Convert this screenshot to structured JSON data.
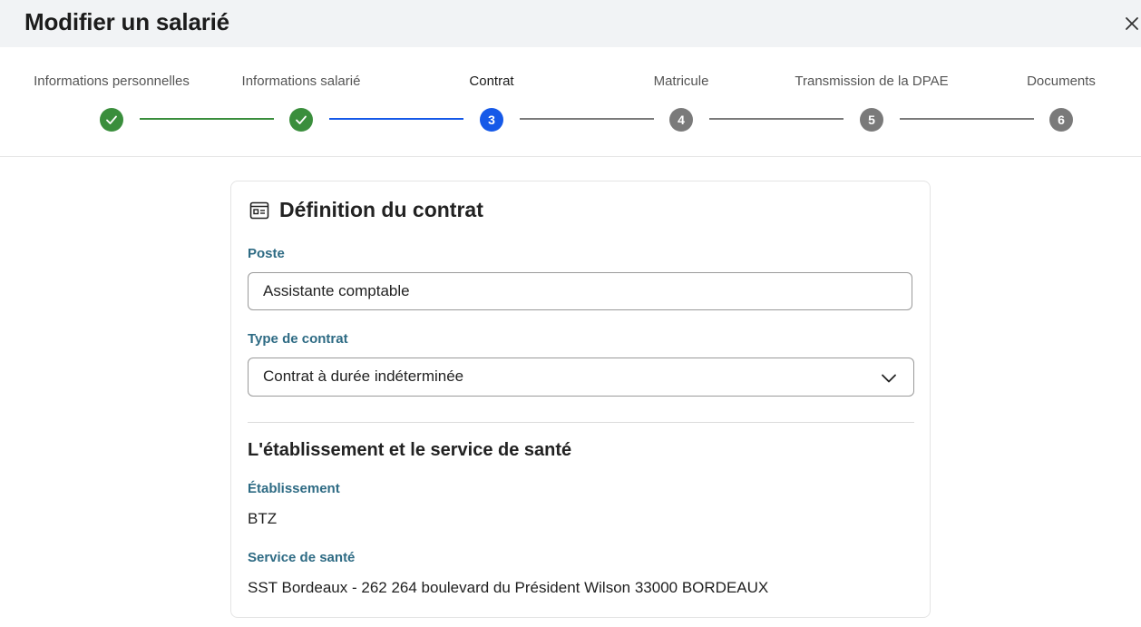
{
  "header": {
    "title": "Modifier un salarié"
  },
  "steps": [
    {
      "label": "Informations personnelles",
      "number": "1",
      "status": "done"
    },
    {
      "label": "Informations salarié",
      "number": "2",
      "status": "done"
    },
    {
      "label": "Contrat",
      "number": "3",
      "status": "active"
    },
    {
      "label": "Matricule",
      "number": "4",
      "status": "todo"
    },
    {
      "label": "Transmission de la DPAE",
      "number": "5",
      "status": "todo"
    },
    {
      "label": "Documents",
      "number": "6",
      "status": "todo"
    }
  ],
  "card": {
    "title": "Définition du contrat",
    "poste": {
      "label": "Poste",
      "value": "Assistante comptable"
    },
    "type_contrat": {
      "label": "Type de contrat",
      "value": "Contrat à durée indéterminée"
    },
    "section_title": "L'établissement et le service de santé",
    "etablissement": {
      "label": "Établissement",
      "value": "BTZ"
    },
    "service_sante": {
      "label": "Service de santé",
      "value": "SST Bordeaux - 262 264 boulevard du Président Wilson 33000 BORDEAUX"
    }
  },
  "colors": {
    "done": "#3a8e3c",
    "active": "#1559e8",
    "todo": "#7a7a7a",
    "label_accent": "#2e6b84"
  }
}
